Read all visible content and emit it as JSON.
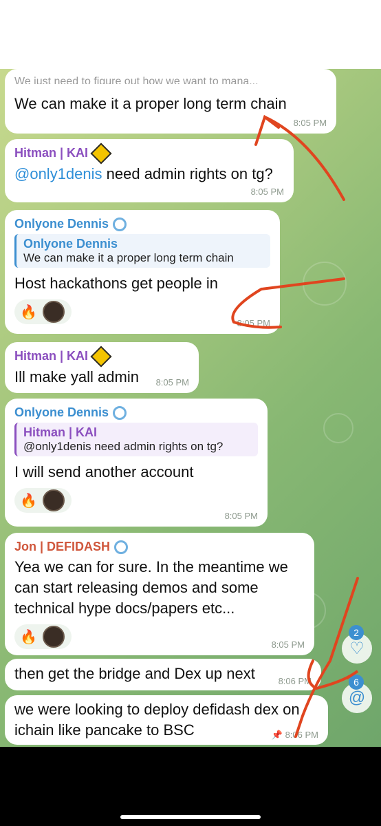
{
  "messages": [
    {
      "id": 1,
      "partial_text": "We just need to figure out how we want to mana...",
      "text": "We can make it a proper long term chain",
      "time": "8:05 PM"
    },
    {
      "id": 2,
      "sender": "Hitman | KAI",
      "mention": "@only1denis",
      "text": " need admin rights on tg?",
      "time": "8:05 PM"
    },
    {
      "id": 3,
      "sender": "Onlyone Dennis",
      "quote_name": "Onlyone Dennis",
      "quote_text": "We can make it a proper long term chain",
      "text": "Host hackathons get people in",
      "time": "8:05 PM",
      "reaction": "🔥"
    },
    {
      "id": 4,
      "sender": "Hitman | KAI",
      "text": "Ill make yall admin",
      "time": "8:05 PM"
    },
    {
      "id": 5,
      "sender": "Onlyone Dennis",
      "quote_name": "Hitman | KAI",
      "quote_text": "@only1denis need admin rights on tg?",
      "text": "I will send another account",
      "time": "8:05 PM",
      "reaction": "🔥"
    },
    {
      "id": 6,
      "sender": "Jon | DEFIDASH",
      "text": "Yea we can for sure. In the meantime we can start releasing demos and some technical hype docs/papers etc...",
      "time": "8:05 PM",
      "reaction": "🔥"
    },
    {
      "id": 7,
      "text": "then get the bridge and Dex up next",
      "time": "8:06 PM"
    },
    {
      "id": 8,
      "text": "we were looking to deploy defidash dex on ichain like pancake to BSC",
      "time": "8:06 PM",
      "pin_icon": "pin-icon"
    }
  ],
  "side_buttons": {
    "reactions_count": "2",
    "mentions_count": "6",
    "reactions_icon": "heart-icon",
    "mentions_icon": "at-icon"
  },
  "colors": {
    "annotation_red": "#e0451f",
    "hitman": "#8b4fbf",
    "dennis": "#3c8fd0",
    "jon": "#d0573c"
  }
}
